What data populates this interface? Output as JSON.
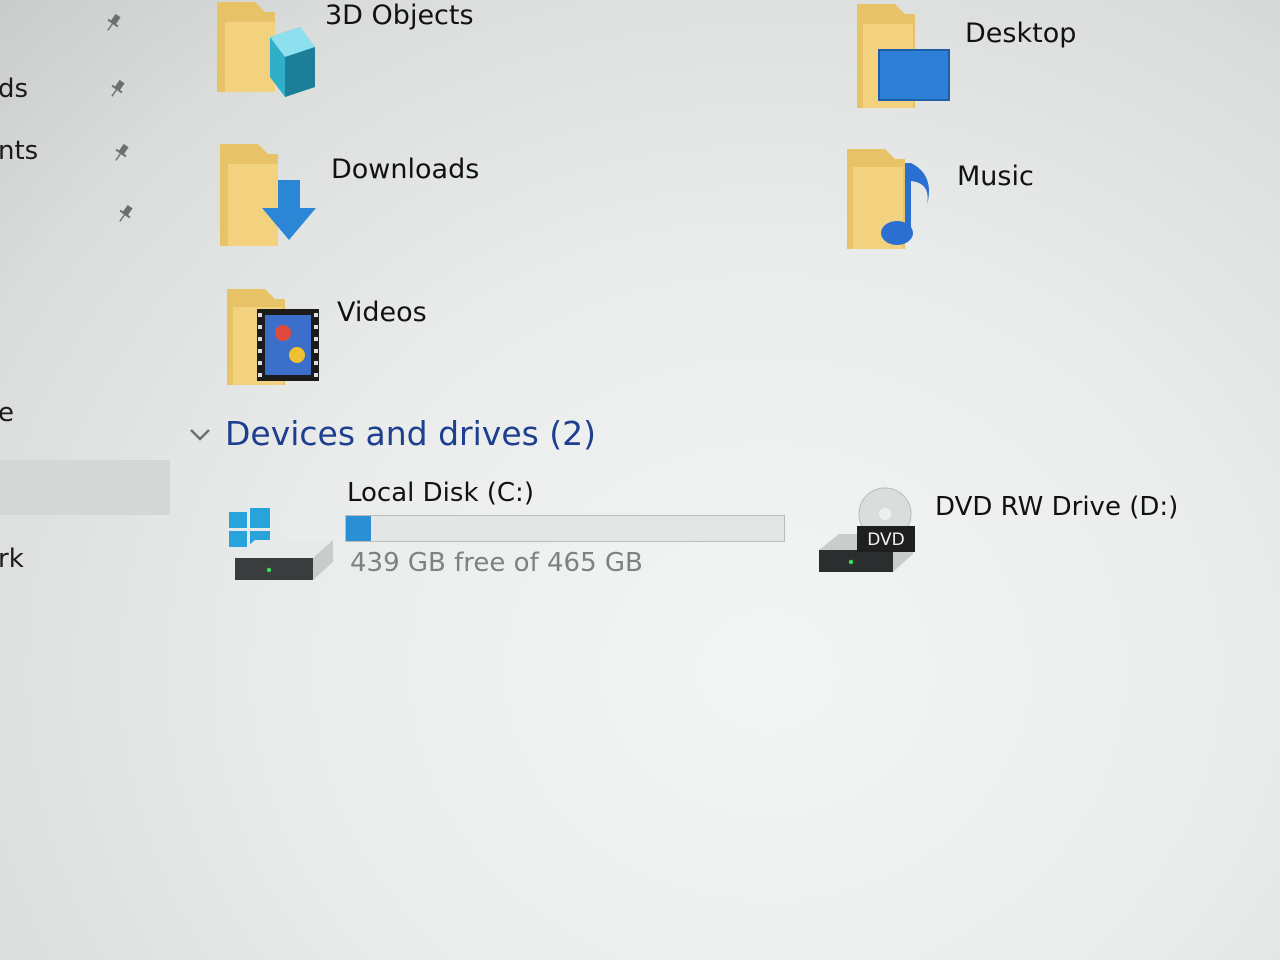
{
  "sidebar": {
    "items": [
      {
        "label": "ds"
      },
      {
        "label": "nts"
      },
      {
        "label": "e"
      },
      {
        "label": "rk"
      }
    ]
  },
  "folders": [
    {
      "label": "3D Objects",
      "icon": "3d-objects-icon"
    },
    {
      "label": "Desktop",
      "icon": "desktop-folder-icon"
    },
    {
      "label": "Downloads",
      "icon": "downloads-folder-icon"
    },
    {
      "label": "Music",
      "icon": "music-folder-icon"
    },
    {
      "label": "Videos",
      "icon": "videos-folder-icon"
    }
  ],
  "devices": {
    "header": "Devices and drives (2)",
    "drives": [
      {
        "name": "Local Disk (C:)",
        "free_text": "439 GB free of 465 GB",
        "used_fraction": 0.056,
        "icon": "windows-drive-icon"
      },
      {
        "name": "DVD RW Drive (D:)",
        "badge": "DVD",
        "icon": "dvd-drive-icon"
      }
    ]
  },
  "colors": {
    "accent_blue": "#2a8fd4",
    "folder_yellow": "#e8c266",
    "header_blue": "#1e3f8f"
  }
}
